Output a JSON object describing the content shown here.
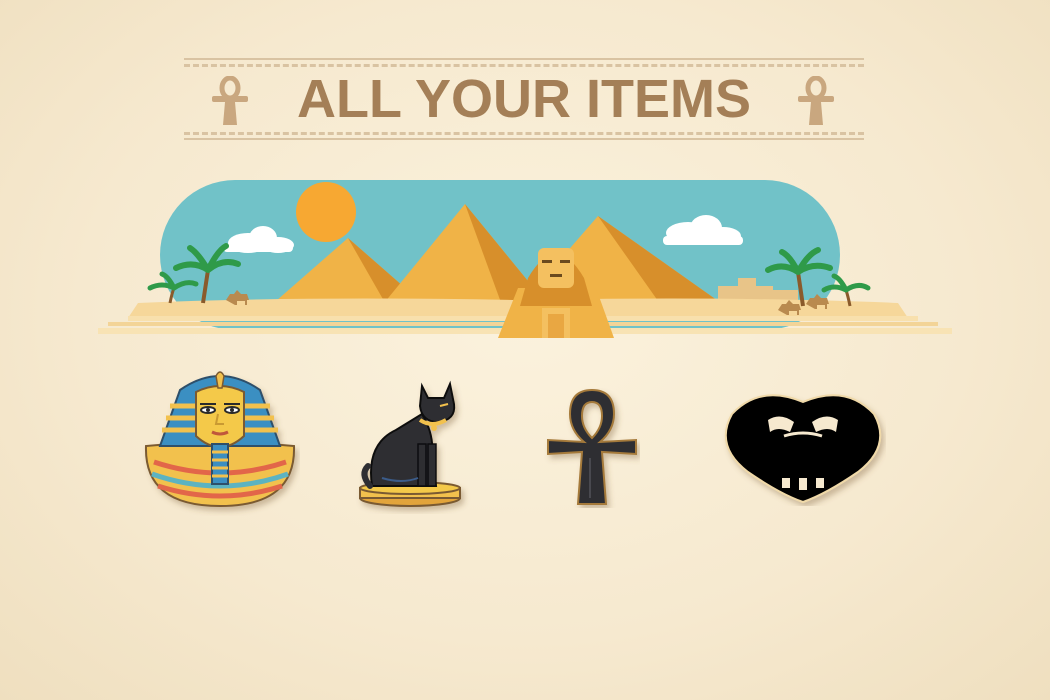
{
  "title": "ALL YOUR ITEMS",
  "colors": {
    "title": "#a47f57",
    "background": "#f6e9cf",
    "sky": "#71c2c8",
    "sun": "#f7a832",
    "sand": "#f6d79a",
    "pyramid_light": "#f0b347",
    "pyramid_dark": "#d78f2b",
    "item_black": "#202020"
  },
  "items": [
    {
      "name": "pharaoh-mask",
      "icon": "pharaoh-mask-icon"
    },
    {
      "name": "bastet-cat",
      "icon": "cat-statue-icon"
    },
    {
      "name": "ankh",
      "icon": "ankh-icon"
    },
    {
      "name": "scarab-heart",
      "icon": "scarab-heart-icon"
    }
  ]
}
